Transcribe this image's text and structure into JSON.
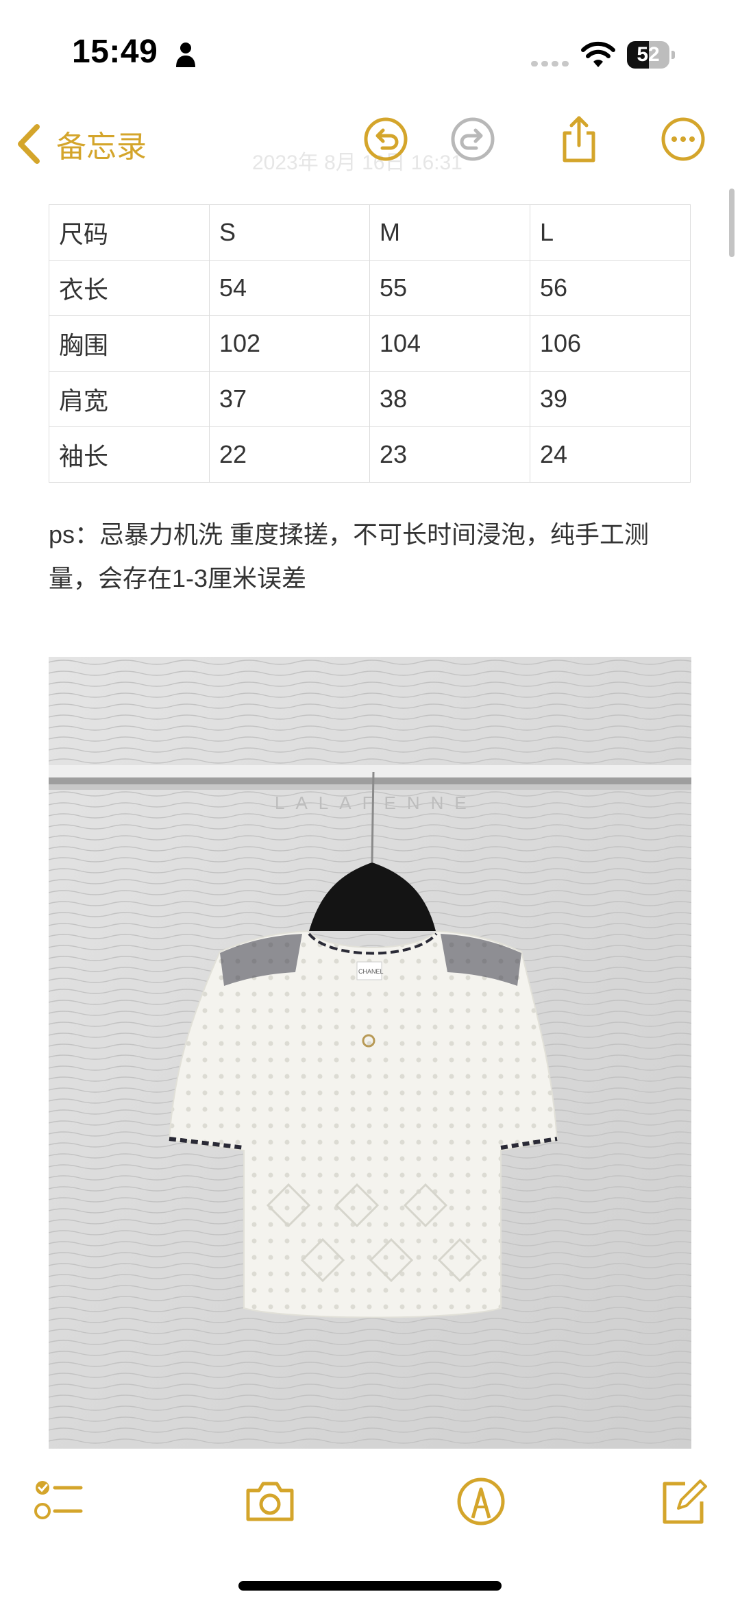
{
  "status_bar": {
    "time": "15:49",
    "battery": "52",
    "battery_level": 0.52
  },
  "nav": {
    "back_label": "备忘录",
    "faint_date": "2023年 8月 16日 16:31"
  },
  "size_table": {
    "rows": [
      [
        "尺码",
        "S",
        "M",
        "L"
      ],
      [
        "衣长",
        "54",
        "55",
        "56"
      ],
      [
        "胸围",
        "102",
        "104",
        "106"
      ],
      [
        "肩宽",
        "37",
        "38",
        "39"
      ],
      [
        "袖长",
        "22",
        "23",
        "24"
      ]
    ]
  },
  "note": {
    "text": "ps：忌暴力机洗 重度揉搓，不可长时间浸泡，纯手工测量，会存在1-3厘米误差"
  },
  "photo": {
    "watermark": "LALAFENNE",
    "label_text": "CHANEL"
  },
  "colors": {
    "accent": "#d4a52b",
    "disabled": "#b8b8b8"
  },
  "icons": [
    "person-icon",
    "signal-icon",
    "wifi-icon",
    "battery-icon",
    "chevron-left-icon",
    "undo-icon",
    "redo-icon",
    "share-icon",
    "more-icon",
    "checklist-icon",
    "camera-icon",
    "markup-icon",
    "compose-icon"
  ]
}
